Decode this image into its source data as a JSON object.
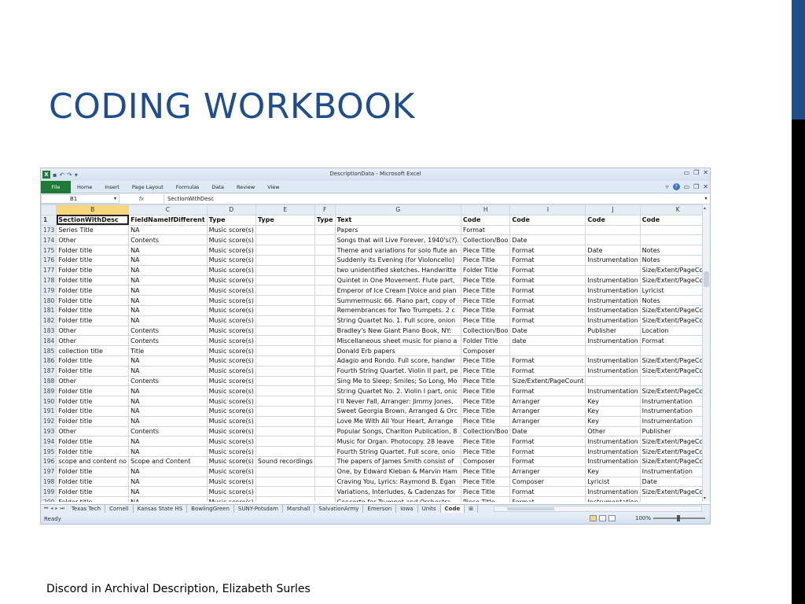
{
  "slide": {
    "title": "CODING WORKBOOK",
    "footer": "Discord in Archival Description, Elizabeth Surles"
  },
  "excel": {
    "window_title": "DescriptionData - Microsoft Excel",
    "qat_icons": [
      "excel-logo-icon",
      "save-icon",
      "undo-icon",
      "redo-icon",
      "customize-qat-icon"
    ],
    "app_logo": "X",
    "ribbon_tabs": [
      "File",
      "Home",
      "Insert",
      "Page Layout",
      "Formulas",
      "Data",
      "Review",
      "View"
    ],
    "name_box": "B1",
    "fx_label": "fx",
    "formula_value": "SectionWithDesc",
    "columns": [
      "B",
      "C",
      "D",
      "E",
      "F",
      "G",
      "H",
      "I",
      "J",
      "K",
      "L"
    ],
    "rows": [
      {
        "num": "1",
        "cells": [
          "SectionWithDesc",
          "FieldNameIfDifferent",
          "Type",
          "Type",
          "Type",
          "Text",
          "Code",
          "Code",
          "Code",
          "Code",
          "Code"
        ]
      },
      {
        "num": "173",
        "cells": [
          "Series Title",
          "NA",
          "Music score(s)",
          "",
          "",
          "Papers",
          "Format",
          "",
          "",
          "",
          ""
        ]
      },
      {
        "num": "174",
        "cells": [
          "Other",
          "Contents",
          "Music score(s)",
          "",
          "",
          "Songs that will Live Forever, 1940's(?).",
          "Collection/Boo",
          "Date",
          "",
          "",
          ""
        ]
      },
      {
        "num": "175",
        "cells": [
          "Folder title",
          "NA",
          "Music score(s)",
          "",
          "",
          "Theme and variations for solo flute an",
          "Piece Title",
          "Format",
          "Date",
          "Notes",
          "Instrume"
        ]
      },
      {
        "num": "176",
        "cells": [
          "Folder title",
          "NA",
          "Music score(s)",
          "",
          "",
          "Suddenly its Evening (for Violoncello)",
          "Piece Title",
          "Format",
          "Instrumentation",
          "Notes",
          "Date"
        ]
      },
      {
        "num": "177",
        "cells": [
          "Folder title",
          "NA",
          "Music score(s)",
          "",
          "",
          "two unidentified sketches. Handwritte",
          "Folder Title",
          "Format",
          "",
          "Size/Extent/PageCount",
          "Date"
        ]
      },
      {
        "num": "178",
        "cells": [
          "Folder title",
          "NA",
          "Music score(s)",
          "",
          "",
          "Quintet in One Movement. Flute part,",
          "Piece Title",
          "Format",
          "Instrumentation",
          "Size/Extent/PageCount",
          "Date"
        ]
      },
      {
        "num": "179",
        "cells": [
          "Folder title",
          "NA",
          "Music score(s)",
          "",
          "",
          "Emperor of Ice Cream [Voice and pian",
          "Piece Title",
          "Format",
          "Instrumentation",
          "Lyricist",
          "Date"
        ]
      },
      {
        "num": "180",
        "cells": [
          "Folder title",
          "NA",
          "Music score(s)",
          "",
          "",
          "Summermusic 66. Piano part, copy of",
          "Piece Title",
          "Format",
          "Instrumentation",
          "Notes",
          "Date"
        ]
      },
      {
        "num": "181",
        "cells": [
          "Folder title",
          "NA",
          "Music score(s)",
          "",
          "",
          "Remembrances for Two Trumpets. 2 c",
          "Piece Title",
          "Format",
          "Instrumentation",
          "Size/Extent/PageCount",
          "Date"
        ]
      },
      {
        "num": "182",
        "cells": [
          "Folder title",
          "NA",
          "Music score(s)",
          "",
          "",
          "String Quartet No. 1. Full score, onion",
          "Piece Title",
          "Format",
          "Instrumentation",
          "Size/Extent/PageCount",
          "Date"
        ]
      },
      {
        "num": "183",
        "cells": [
          "Other",
          "Contents",
          "Music score(s)",
          "",
          "",
          "Bradley's New Giant Piano Book, NY:",
          "Collection/Boo",
          "Date",
          "Publisher",
          "Location",
          "Instrume"
        ]
      },
      {
        "num": "184",
        "cells": [
          "Other",
          "Contents",
          "Music score(s)",
          "",
          "",
          "Miscellaneous sheet music for piano a",
          "Folder Title",
          "date",
          "Instrumentation",
          "Format",
          ""
        ]
      },
      {
        "num": "185",
        "cells": [
          "collection title",
          "Title",
          "Music score(s)",
          "",
          "",
          "Donald Erb papers",
          "Composer",
          "",
          "",
          "",
          ""
        ]
      },
      {
        "num": "186",
        "cells": [
          "Folder title",
          "NA",
          "Music score(s)",
          "",
          "",
          "Adagio and Rondo. Full score, handwr",
          "Piece Title",
          "Format",
          "Instrumentation",
          "Size/Extent/PageCount",
          "Date"
        ]
      },
      {
        "num": "187",
        "cells": [
          "Folder title",
          "NA",
          "Music score(s)",
          "",
          "",
          "Fourth String Quartet. Violin II part, pe",
          "Piece Title",
          "Format",
          "Instrumentation",
          "Size/Extent/PageCount",
          "Date"
        ]
      },
      {
        "num": "188",
        "cells": [
          "Other",
          "Contents",
          "Music score(s)",
          "",
          "",
          "Sing Me to Sleep; Smiles; So Long, Mo",
          "Piece Title",
          "Size/Extent/PageCount",
          "",
          "",
          ""
        ]
      },
      {
        "num": "189",
        "cells": [
          "Folder title",
          "NA",
          "Music score(s)",
          "",
          "",
          "String Quartet No. 2. Violin I part, onic",
          "Piece Title",
          "Format",
          "Instrumentation",
          "Size/Extent/PageCount",
          "Date"
        ]
      },
      {
        "num": "190",
        "cells": [
          "Folder title",
          "NA",
          "Music score(s)",
          "",
          "",
          "I'll Never Fall, Arranger: Jimmy Jones,",
          "Piece Title",
          "Arranger",
          "Key",
          "Instrumentation",
          "date"
        ]
      },
      {
        "num": "191",
        "cells": [
          "Folder title",
          "NA",
          "Music score(s)",
          "",
          "",
          "Sweet Georgia Brown, Arranged & Orc",
          "Piece Title",
          "Arranger",
          "Key",
          "Instrumentation",
          "Date"
        ]
      },
      {
        "num": "192",
        "cells": [
          "Folder title",
          "NA",
          "Music score(s)",
          "",
          "",
          "Love Me With All Your Heart, Arrange",
          "Piece Title",
          "Arranger",
          "Key",
          "Instrumentation",
          "Date"
        ]
      },
      {
        "num": "193",
        "cells": [
          "Other",
          "Contents",
          "Music score(s)",
          "",
          "",
          "Popular Songs, Charlton Publication, 8",
          "Collection/Boo",
          "Date",
          "Other",
          "Publisher",
          ""
        ]
      },
      {
        "num": "194",
        "cells": [
          "Folder title",
          "NA",
          "Music score(s)",
          "",
          "",
          "Music for Organ. Photocopy. 28 leave",
          "Piece Title",
          "Format",
          "Instrumentation",
          "Size/Extent/PageCount",
          "Date"
        ]
      },
      {
        "num": "195",
        "cells": [
          "Folder title",
          "NA",
          "Music score(s)",
          "",
          "",
          "Fourth String Quartet. Full score, onio",
          "Piece Title",
          "Format",
          "Instrumentation",
          "Size/Extent/PageCount",
          "Date"
        ]
      },
      {
        "num": "196",
        "cells": [
          "scope and content no",
          "Scope and Content",
          "Music score(s)",
          "Sound recordings",
          "",
          "The papers of James Smith consist of",
          "Composer",
          "Format",
          "Instrumentation",
          "Size/Extent/PageCount",
          ""
        ]
      },
      {
        "num": "197",
        "cells": [
          "Folder title",
          "NA",
          "Music score(s)",
          "",
          "",
          "One, by Edward Kleban & Marvin Ham",
          "Piece Title",
          "Arranger",
          "Key",
          "Instrumentation",
          "Date"
        ]
      },
      {
        "num": "198",
        "cells": [
          "Folder title",
          "NA",
          "Music score(s)",
          "",
          "",
          "Craving You, Lyrics: Raymond B. Egan",
          "Piece Title",
          "Composer",
          "Lyricist",
          "Date",
          ""
        ]
      },
      {
        "num": "199",
        "cells": [
          "Folder title",
          "NA",
          "Music score(s)",
          "",
          "",
          "Variations, Interludes, & Cadenzas for",
          "Piece Title",
          "Format",
          "Instrumentation",
          "Size/Extent/PageCount",
          "Date"
        ]
      },
      {
        "num": "200",
        "cells": [
          "Folder title",
          "NA",
          "Music score(s)",
          "",
          "",
          "Concerto for Trumpet and Orchestra.",
          "Piece Title",
          "Format",
          "Instrumentation",
          "",
          "Date"
        ]
      }
    ],
    "sheet_tabs": [
      "Texas Tech",
      "Cornell",
      "Kansas State HS",
      "BowlingGreen",
      "SUNY-Potsdam",
      "Marshall",
      "SalvationArmy",
      "Emerson",
      "Iowa",
      "Units",
      "Code"
    ],
    "active_sheet": "Code",
    "status": "Ready",
    "zoom": "100%"
  }
}
